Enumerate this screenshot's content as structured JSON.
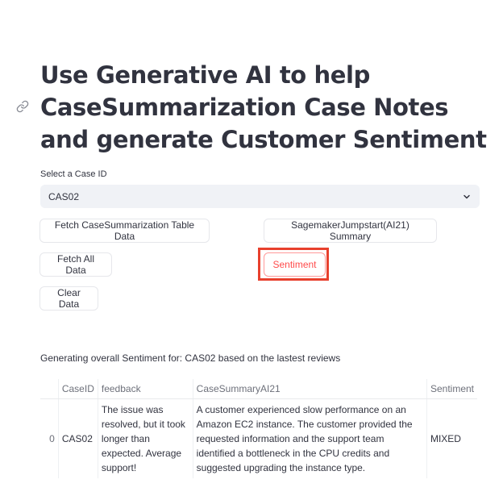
{
  "title": "Use Generative AI to help CaseSummarization Case Notes and generate Customer Sentiment",
  "select": {
    "label": "Select a Case ID",
    "value": "CAS02"
  },
  "buttons": {
    "fetch_case_table": "Fetch CaseSummarization Table Data",
    "sagemaker_summary": "SagemakerJumpstart(AI21) Summary",
    "fetch_all": "Fetch All Data",
    "sentiment": "Sentiment",
    "clear": "Clear Data"
  },
  "status_text": "Generating overall Sentiment for: CAS02 based on the lastest reviews",
  "table": {
    "headers": [
      "",
      "CaseID",
      "feedback",
      "CaseSummaryAI21",
      "Sentiment"
    ],
    "rows": [
      [
        "0",
        "CAS02",
        "The issue was resolved, but it took longer than expected. Average support!",
        "A customer experienced slow performance on an Amazon EC2 instance. The customer provided the requested information and the support team identified a bottleneck in the CPU credits and suggested upgrading the instance type.",
        "MIXED"
      ]
    ]
  },
  "colors": {
    "accent": "#ff4b4b",
    "highlight": "#e8402d",
    "select_bg": "#f0f2f6"
  }
}
